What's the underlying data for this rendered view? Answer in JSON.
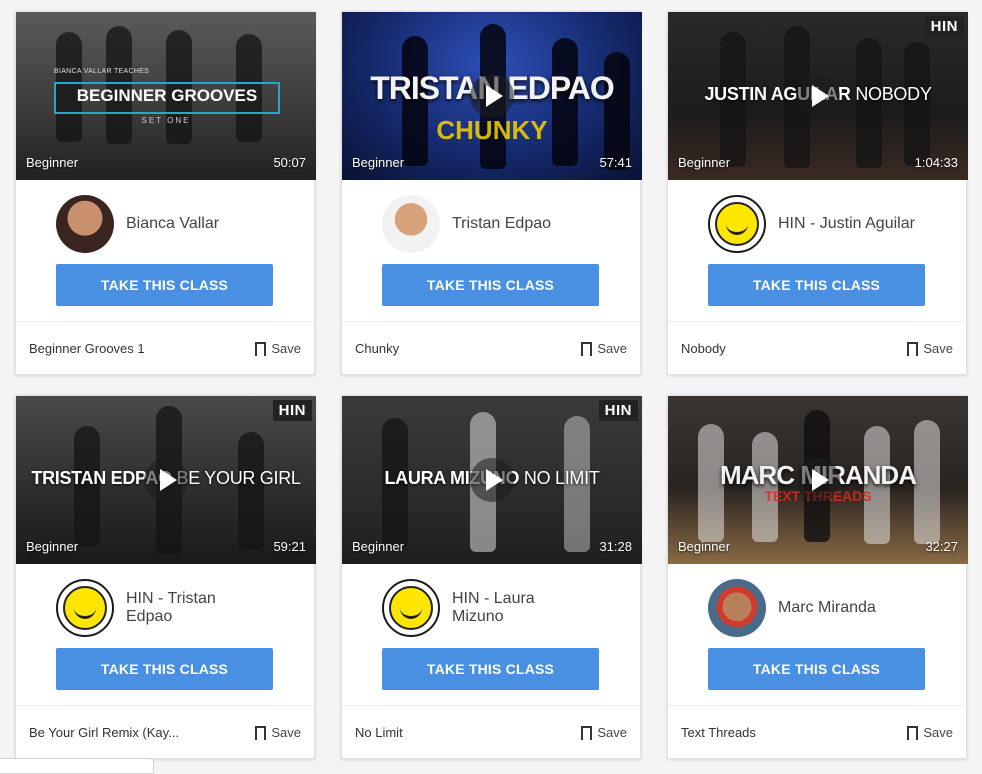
{
  "colors": {
    "accent": "#4a90e2",
    "badge_bg": "#222222"
  },
  "cards": [
    {
      "thumb": {
        "level": "Beginner",
        "duration": "50:07",
        "badge": "",
        "teach_small": "BIANCA VALLAR TEACHES",
        "teach_title": "BEGINNER GROOVES",
        "teach_set": "SET ONE"
      },
      "instructor": "Bianca Vallar",
      "button": "TAKE THIS CLASS",
      "class_title": "Beginner Grooves 1",
      "save": "Save"
    },
    {
      "thumb": {
        "level": "Beginner",
        "duration": "57:41",
        "badge": "",
        "title": "TRISTAN EDPAO",
        "subtitle": "CHUNKY"
      },
      "instructor": "Tristan Edpao",
      "button": "TAKE THIS CLASS",
      "class_title": "Chunky",
      "save": "Save"
    },
    {
      "thumb": {
        "level": "Beginner",
        "duration": "1:04:33",
        "badge": "HIN",
        "title_bold": "JUSTIN AGUILAR",
        "title_thin": "NOBODY"
      },
      "instructor": "HIN - Justin Aguilar",
      "button": "TAKE THIS CLASS",
      "class_title": "Nobody",
      "save": "Save"
    },
    {
      "thumb": {
        "level": "Beginner",
        "duration": "59:21",
        "badge": "HIN",
        "title_bold": "TRISTAN EDPAO",
        "title_thin": "BE YOUR GIRL"
      },
      "instructor": "HIN - Tristan Edpao",
      "button": "TAKE THIS CLASS",
      "class_title": "Be Your Girl Remix (Kay...",
      "save": "Save"
    },
    {
      "thumb": {
        "level": "Beginner",
        "duration": "31:28",
        "badge": "HIN",
        "title_bold": "LAURA MIZUNO",
        "title_thin": "NO LIMIT"
      },
      "instructor": "HIN - Laura Mizuno",
      "button": "TAKE THIS CLASS",
      "class_title": "No Limit",
      "save": "Save"
    },
    {
      "thumb": {
        "level": "Beginner",
        "duration": "32:27",
        "badge": "",
        "title": "MARC MIRANDA",
        "subtitle": "TEXT THREADS"
      },
      "instructor": "Marc Miranda",
      "button": "TAKE THIS CLASS",
      "class_title": "Text Threads",
      "save": "Save"
    }
  ]
}
